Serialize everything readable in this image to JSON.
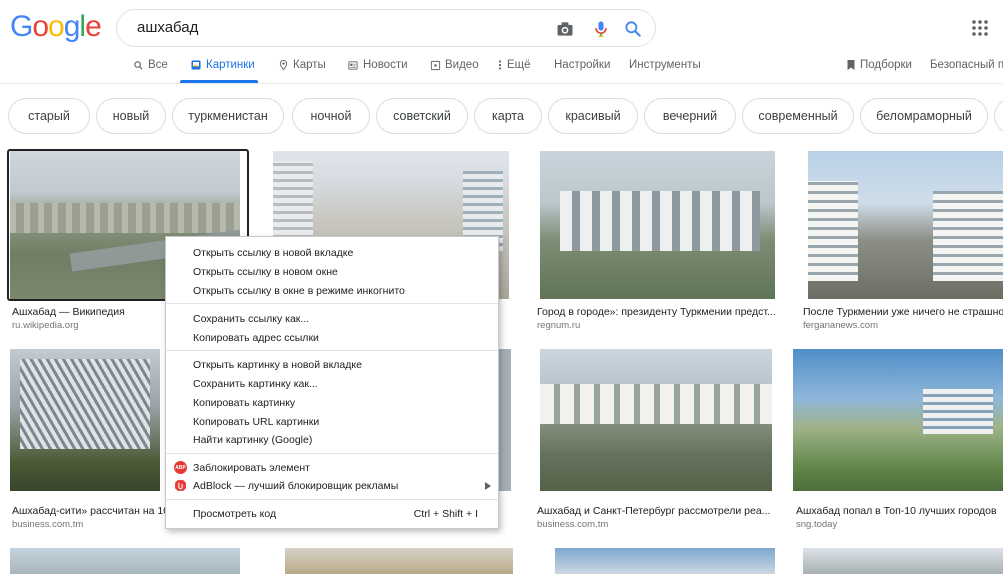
{
  "logo": {
    "text": "Google",
    "colors": [
      "#4285f4",
      "#ea4335",
      "#fbbc05",
      "#4285f4",
      "#34a853",
      "#ea4335"
    ]
  },
  "search": {
    "value": "ашхабад"
  },
  "tabs": [
    {
      "label": "Все",
      "icon": "search-icon"
    },
    {
      "label": "Картинки",
      "icon": "image-icon",
      "active": true
    },
    {
      "label": "Карты",
      "icon": "map-pin-icon"
    },
    {
      "label": "Новости",
      "icon": "news-icon"
    },
    {
      "label": "Видео",
      "icon": "video-icon"
    },
    {
      "label": "Ещё",
      "icon": "more-vert-icon"
    },
    {
      "label": "Настройки"
    },
    {
      "label": "Инструменты"
    }
  ],
  "right_tabs": {
    "collections": "Подборки",
    "safe": "Безопасный п"
  },
  "chips": [
    "старый",
    "новый",
    "туркменистан",
    "ночной",
    "советский",
    "карта",
    "красивый",
    "вечерний",
    "современный",
    "беломраморный"
  ],
  "results_row1": [
    {
      "title": "Ашхабад — Википедия",
      "source": "ru.wikipedia.org"
    },
    {
      "title": "",
      "source": ""
    },
    {
      "title": "Город в городе»: президенту Туркмении предст...",
      "source": "regnum.ru"
    },
    {
      "title": "После Туркмении уже ничего не страшно",
      "source": "fergananews.com"
    }
  ],
  "results_row2": [
    {
      "title": "Ашхабад-сити» рассчитан на 10",
      "source": "business.com.tm"
    },
    {
      "title": "",
      "source": ""
    },
    {
      "title": "Ашхабад и Санкт-Петербург рассмотрели реа...",
      "source": "business.com.tm"
    },
    {
      "title": "Ашхабад попал в Топ-10 лучших городов",
      "source": "sng.today"
    }
  ],
  "context_menu": {
    "open_new_tab": "Открыть ссылку в новой вкладке",
    "open_new_window": "Открыть ссылку в новом окне",
    "open_incognito": "Открыть ссылку в окне в режиме инкогнито",
    "save_link": "Сохранить ссылку как...",
    "copy_link": "Копировать адрес ссылки",
    "open_image": "Открыть картинку в новой вкладке",
    "save_image": "Сохранить картинку как...",
    "copy_image": "Копировать картинку",
    "copy_image_url": "Копировать URL картинки",
    "search_image": "Найти картинку (Google)",
    "block_element": "Заблокировать элемент",
    "adblock": "AdBlock — лучший блокировщик рекламы",
    "inspect": "Просмотреть код",
    "inspect_shortcut": "Ctrl + Shift + I",
    "abp_badge": "ABP"
  }
}
